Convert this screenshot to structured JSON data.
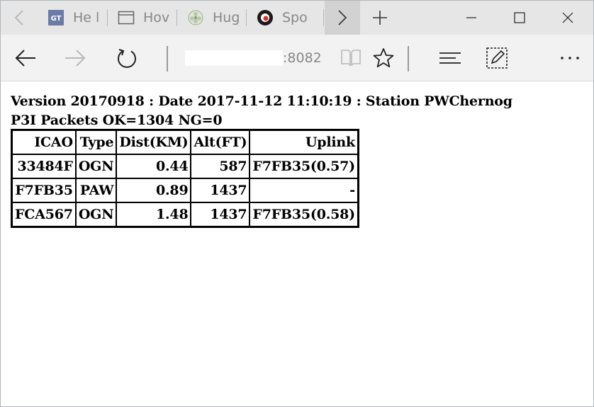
{
  "browser": {
    "tabs": [
      {
        "label": "He l",
        "icon": "gt-icon"
      },
      {
        "label": "Hov",
        "icon": "window-icon"
      },
      {
        "label": "Hug",
        "icon": "flower-icon"
      },
      {
        "label": "Spo",
        "icon": "spotify-icon"
      }
    ],
    "address": {
      "port_text": ":8082"
    },
    "icons": {
      "back": "arrow-left-icon",
      "forward": "arrow-right-icon",
      "refresh": "refresh-icon",
      "reading": "book-icon",
      "favorite": "star-icon",
      "hub": "hub-icon",
      "note": "pen-icon",
      "more": "ellipsis-icon"
    }
  },
  "page": {
    "line1": "Version 20170918 : Date 2017-11-12 11:10:19 : Station PWChernog",
    "line2": "P3I Packets OK=1304 NG=0",
    "table": {
      "headers": [
        "ICAO",
        "Type",
        "Dist(KM)",
        "Alt(FT)",
        "Uplink"
      ],
      "rows": [
        [
          "33484F",
          "OGN",
          "0.44",
          "587",
          "F7FB35(0.57)"
        ],
        [
          "F7FB35",
          "PAW",
          "0.89",
          "1437",
          "-"
        ],
        [
          "FCA567",
          "OGN",
          "1.48",
          "1437",
          "F7FB35(0.58)"
        ]
      ]
    }
  }
}
